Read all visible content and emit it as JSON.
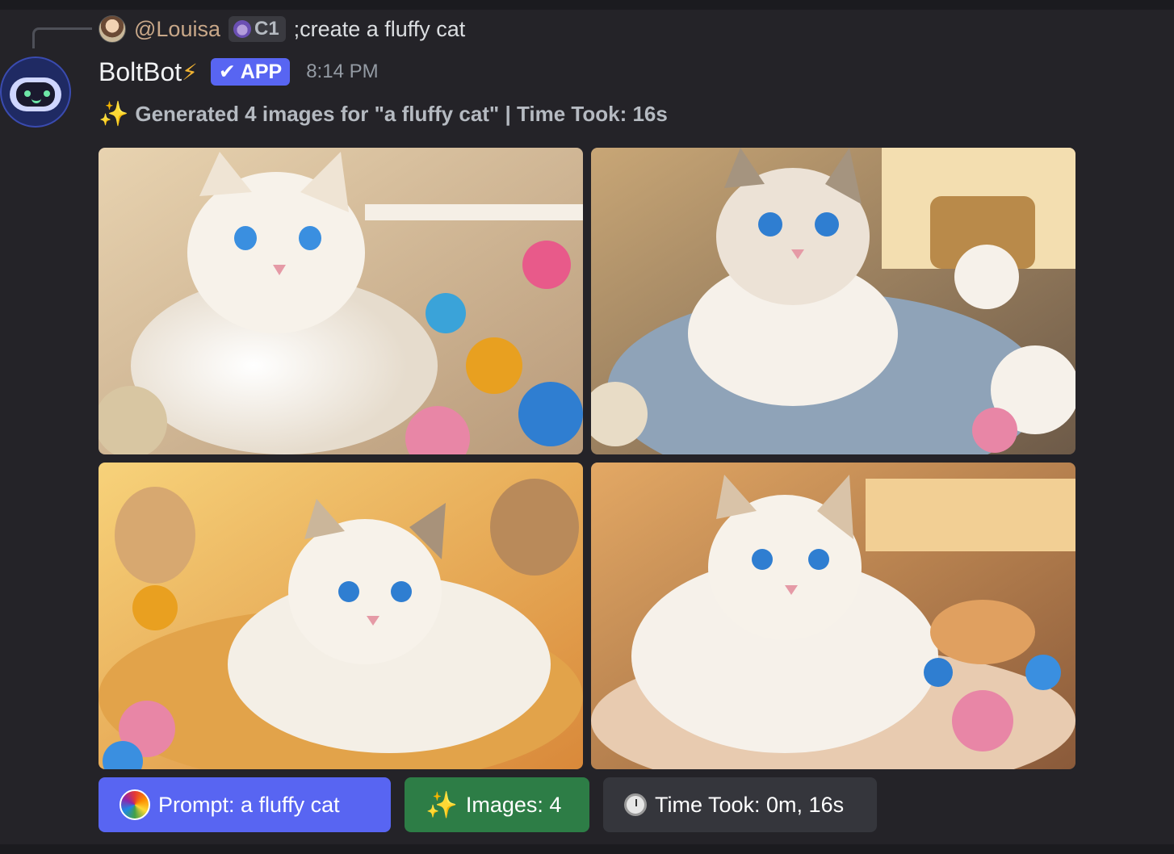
{
  "reply": {
    "username": "@Louisa",
    "clan_tag": "C1",
    "message": ";create a fluffy cat",
    "avatar_icon": "user-avatar"
  },
  "bot": {
    "name": "BoltBot",
    "name_icon": "lightning-icon",
    "badge": "APP",
    "badge_icon": "checkmark-icon",
    "timestamp": "8:14 PM"
  },
  "summary": {
    "icon": "sparkles-icon",
    "text": "Generated 4 images for \"a fluffy cat\" | Time Took: 16s"
  },
  "images": [
    {
      "subject": "fluffy white cat with blue eyes on blanket with yarn balls",
      "palette": [
        "#f4e3c8",
        "#c9b08a",
        "#3a8fe0"
      ]
    },
    {
      "subject": "fluffy cat on gray-blue knit blanket with plush toys",
      "palette": [
        "#e9d7b8",
        "#8fa3b8",
        "#c98a3a"
      ]
    },
    {
      "subject": "fluffy white cat in warm sunlight with teddy bears",
      "palette": [
        "#f5c86a",
        "#d98a3a",
        "#f0e6d6"
      ]
    },
    {
      "subject": "fluffy cat on knit blanket with yarn balls and bokeh",
      "palette": [
        "#f2b66a",
        "#a86a3a",
        "#f3e8d8"
      ]
    }
  ],
  "buttons": {
    "prompt": {
      "label": "Prompt: a fluffy cat",
      "icon": "color-wheel-icon",
      "color": "#5865f2"
    },
    "images": {
      "label": "Images: 4",
      "icon": "sparkles-icon",
      "color": "#2d7d46"
    },
    "time": {
      "label": "Time Took: 0m, 16s",
      "icon": "stopwatch-icon",
      "color": "#35363c"
    }
  },
  "colors": {
    "background": "#242328",
    "accent": "#5865f2",
    "muted_text": "#b5bac1"
  }
}
